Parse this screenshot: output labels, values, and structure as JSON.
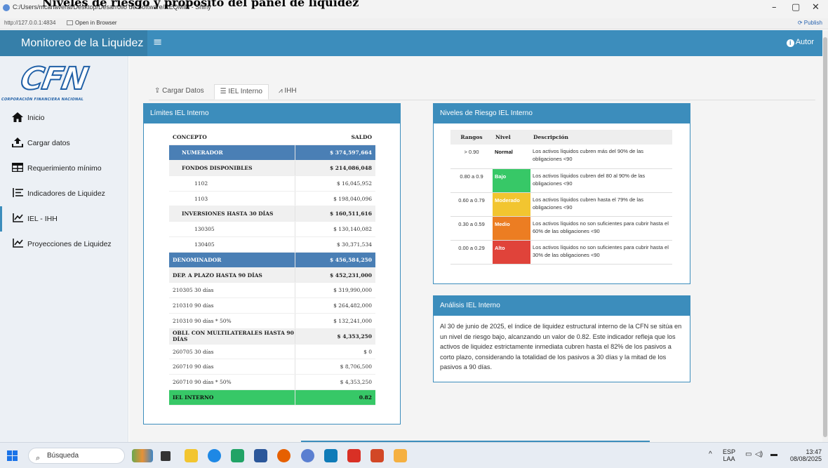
{
  "window": {
    "overlay_title": "Niveles de riesgo y propósito del panel de liquidez",
    "title": "C:/Users/mcanaveral/Desktop/Desarrollo de Software/REQMIN - Shiny",
    "minimize": "–",
    "maximize": "▢",
    "close": "✕"
  },
  "addressbar": {
    "url": "http://127.0.0.1:4834",
    "open_in_browser": "Open in Browser",
    "publish": "Publish"
  },
  "header": {
    "brand": "Monitoreo de la Liquidez",
    "menu_icon": "≡",
    "autor": "Autor",
    "accent": "#3c8dbc"
  },
  "logo": {
    "text": "CFN",
    "subtitle": "CORPORACIÓN FINANCIERA NACIONAL"
  },
  "sidebar": {
    "items": [
      {
        "label": "Inicio",
        "icon": "home-icon"
      },
      {
        "label": "Cargar datos",
        "icon": "upload-icon"
      },
      {
        "label": "Requerimiento mínimo",
        "icon": "table-icon"
      },
      {
        "label": "Indicadores de Liquidez",
        "icon": "list-icon"
      },
      {
        "label": "IEL - IHH",
        "icon": "line-chart-icon",
        "active": true
      },
      {
        "label": "Proyecciones de Liquidez",
        "icon": "line-chart-icon"
      }
    ]
  },
  "tabs": [
    {
      "label": "Cargar Datos",
      "icon": "upload-icon"
    },
    {
      "label": "IEL Interno",
      "icon": "list-icon",
      "active": true
    },
    {
      "label": "IHH",
      "icon": "line-chart-icon"
    }
  ],
  "limits": {
    "title": "Límites IEL Interno",
    "col_concepto": "CONCEPTO",
    "col_saldo": "SALDO",
    "rows": [
      {
        "type": "numer",
        "concepto": "NUMERADOR",
        "saldo": "$ 374,597,664"
      },
      {
        "type": "grp",
        "concepto": "FONDOS DISPONIBLES",
        "saldo": "$ 214,086,048"
      },
      {
        "type": "item",
        "concepto": "1102",
        "saldo": "$ 16,045,952"
      },
      {
        "type": "item",
        "concepto": "1103",
        "saldo": "$ 198,040,096"
      },
      {
        "type": "grp",
        "concepto": "INVERSIONES HASTA 30 DÍAS",
        "saldo": "$ 160,511,616"
      },
      {
        "type": "item",
        "concepto": "130305",
        "saldo": "$ 130,140,082"
      },
      {
        "type": "item",
        "concepto": "130405",
        "saldo": "$ 30,371,534"
      },
      {
        "type": "denom",
        "concepto": "DENOMINADOR",
        "saldo": "$ 456,584,250"
      },
      {
        "type": "sec",
        "concepto": "DEP. A PLAZO HASTA 90 DÍAS",
        "saldo": "$ 452,231,000"
      },
      {
        "type": "plain",
        "concepto": "210305 30 días",
        "saldo": "$ 319,990,000"
      },
      {
        "type": "plain",
        "concepto": "210310 90 días",
        "saldo": "$ 264,482,000"
      },
      {
        "type": "plain",
        "concepto": "210310 90 días * 50%",
        "saldo": "$ 132,241,000"
      },
      {
        "type": "sec",
        "concepto": "OBLI. CON MULTILATERALES HASTA 90 DÍAS",
        "saldo": "$ 4,353,250"
      },
      {
        "type": "plain",
        "concepto": "260705 30 días",
        "saldo": "$ 0"
      },
      {
        "type": "plain",
        "concepto": "260710 90 días",
        "saldo": "$ 8,706,500"
      },
      {
        "type": "plain",
        "concepto": "260710 90 días * 50%",
        "saldo": "$ 4,353,250"
      },
      {
        "type": "iel",
        "concepto": "IEL INTERNO",
        "saldo": "0.82"
      }
    ]
  },
  "risk": {
    "title": "Niveles de Riesgo IEL Interno",
    "col_rangos": "Rangos",
    "col_nivel": "Nivel",
    "col_descripcion": "Descripción",
    "rows": [
      {
        "rango": "> 0.90",
        "nivel": "Normal",
        "color": "#ffffff",
        "descripcion": "Los activos líquidos cubren más del 90% de las obligaciones <90"
      },
      {
        "rango": "0.80 a 0.9",
        "nivel": "Bajo",
        "color": "#37c867",
        "descripcion": "Los activos líquidos cubren del 80 al 90% de las obligaciones <90"
      },
      {
        "rango": "0.60 a 0.79",
        "nivel": "Moderado",
        "color": "#f2c530",
        "descripcion": "Los activos líquidos cubren hasta el 79% de las obligaciones <90"
      },
      {
        "rango": "0.30 a 0.59",
        "nivel": "Medio",
        "color": "#ec7d22",
        "descripcion": "Los activos líquidos no son suficientes para cubrir hasta el 60% de las obligaciones <90"
      },
      {
        "rango": "0.00 a 0.29",
        "nivel": "Alto",
        "color": "#e0433a",
        "descripcion": "Los activos líquidos no son suficientes para cubrir hasta el 30% de las obligaciones <90"
      }
    ]
  },
  "analysis": {
    "title": "Análisis IEL Interno",
    "text": "Al 30 de junio de 2025, el índice de liquidez estructural interno de la CFN se sitúa en un nivel de riesgo bajo, alcanzando un valor de 0.82. Este indicador refleja que los activos de liquidez estrictamente inmediata cubren hasta el 82% de los pasivos a corto plazo, considerando la totalidad de los pasivos a 30 días y la mitad de los pasivos a 90 días."
  },
  "taskbar": {
    "search": "Búsqueda",
    "lang_top": "ESP",
    "lang_bottom": "LAA",
    "time": "13:47",
    "date": "08/08/2025"
  }
}
